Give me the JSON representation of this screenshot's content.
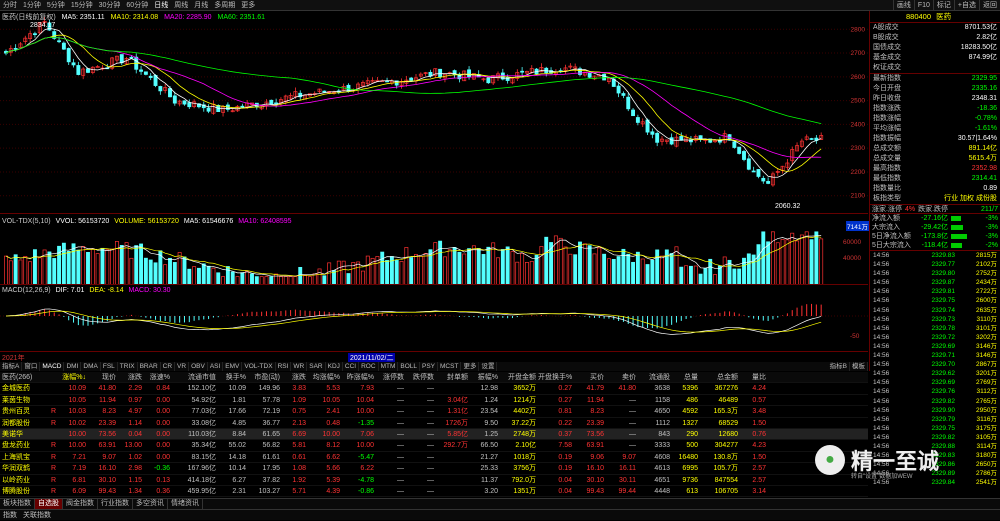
{
  "topbar": {
    "tabs": [
      "分时",
      "1分钟",
      "5分钟",
      "15分钟",
      "30分钟",
      "60分钟",
      "日线",
      "周线",
      "月线",
      "多周期",
      "更多"
    ],
    "active_tab": "日线",
    "right_tabs": [
      "画线",
      "F10",
      "标记",
      "+自选",
      "返回"
    ]
  },
  "main_legend": {
    "name": "医药(日线前复权)",
    "ma5": "MA5: 2351.11",
    "ma10": "MA10: 2314.08",
    "ma20": "MA20: 2285.90",
    "ma60": "MA60: 2351.61"
  },
  "main_labels": {
    "high": "2834.17",
    "low": "2060.32"
  },
  "y_axis": [
    "2800",
    "2700",
    "2600",
    "2500",
    "2400",
    "2300",
    "2200",
    "2100"
  ],
  "vol_legend": {
    "name": "VOL-TDX(5,10)",
    "vvol": "VVOL: 56153720",
    "volume": "VOLUME: 56153720",
    "ma5": "MA5: 61546676",
    "ma10": "MA10: 62408595",
    "max": "7141万",
    "y1": "40000",
    "y2": "60000"
  },
  "macd_legend": {
    "name": "MACD(12,26,9)",
    "dif": "DIF: 7.01",
    "dea": "DEA: -8.14",
    "macd": "MACD: 30.30",
    "y": "-50"
  },
  "time_axis": {
    "left": "2021年",
    "cursor": "2021/11/02/二"
  },
  "indicator_tabs": [
    "指标A",
    "窗口",
    "MACD",
    "DMI",
    "DMA",
    "FSL",
    "TRIX",
    "BRAR",
    "CR",
    "VR",
    "OBV",
    "ASI",
    "EMV",
    "VOL-TDX",
    "RSI",
    "WR",
    "SAR",
    "KDJ",
    "CCI",
    "ROC",
    "MTM",
    "BOLL",
    "PSY",
    "MCST",
    "更多",
    "设置"
  ],
  "indicator_right": [
    "指标B",
    "模板"
  ],
  "right_panel": {
    "code": "880400",
    "name": "医药",
    "stats1": [
      {
        "k": "A股成交",
        "v": "8701.53亿",
        "c": "#fff"
      },
      {
        "k": "B股成交",
        "v": "2.82亿",
        "c": "#fff"
      },
      {
        "k": "国债成交",
        "v": "18283.50亿",
        "c": "#fff"
      },
      {
        "k": "基金成交",
        "v": "874.99亿",
        "c": "#fff"
      },
      {
        "k": "权证成交",
        "v": "",
        "c": "#fff"
      }
    ],
    "stats2": [
      {
        "k": "最新指数",
        "v": "2329.95",
        "c": "#0f0"
      },
      {
        "k": "今日开盘",
        "v": "2335.16",
        "c": "#0f0"
      },
      {
        "k": "昨日收盘",
        "v": "2348.31",
        "c": "#fff"
      },
      {
        "k": "指数涨跌",
        "v": "-18.36",
        "c": "#0f0"
      },
      {
        "k": "指数涨幅",
        "v": "-0.78%",
        "c": "#0f0"
      },
      {
        "k": "平均涨幅",
        "v": "-1.61%",
        "c": "#0f0"
      },
      {
        "k": "指数振幅",
        "v": "30.57|1.64%",
        "c": "#fff"
      },
      {
        "k": "总成交额",
        "v": "891.14亿",
        "c": "#ff0"
      },
      {
        "k": "总成交量",
        "v": "5615.4万",
        "c": "#ff0"
      },
      {
        "k": "最高指数",
        "v": "2352.98",
        "c": "#f33"
      },
      {
        "k": "最低指数",
        "v": "2314.41",
        "c": "#0f0"
      },
      {
        "k": "指数量比",
        "v": "0.89",
        "c": "#fff"
      },
      {
        "k": "板指类型",
        "v": "行业 加权 成份股",
        "c": "#ff0"
      }
    ],
    "updown": {
      "label1": "涨家.涨停",
      "v1": "4%",
      "label2": "跌家.跌停",
      "v2": "211/7"
    },
    "flows": [
      {
        "k": "净流入额",
        "v": "-27.16亿",
        "p": "-3%",
        "w": 10
      },
      {
        "k": "大宗流入",
        "v": "-29.42亿",
        "p": "-3%",
        "w": 12
      },
      {
        "k": "5日净流入额",
        "v": "-173.8亿",
        "p": "-3%",
        "w": 16
      },
      {
        "k": "5日大宗流入",
        "v": "-118.4亿",
        "p": "-2%",
        "w": 11
      }
    ],
    "ticks": [
      {
        "t": "14:56",
        "p": "2329.83",
        "v": "2815万"
      },
      {
        "t": "14:56",
        "p": "2329.77",
        "v": "2102万"
      },
      {
        "t": "14:56",
        "p": "2329.80",
        "v": "2752万"
      },
      {
        "t": "14:56",
        "p": "2329.87",
        "v": "2434万"
      },
      {
        "t": "14:56",
        "p": "2329.81",
        "v": "2722万"
      },
      {
        "t": "14:56",
        "p": "2329.75",
        "v": "2600万"
      },
      {
        "t": "14:56",
        "p": "2329.74",
        "v": "2635万"
      },
      {
        "t": "14:56",
        "p": "2329.73",
        "v": "3110万"
      },
      {
        "t": "14:56",
        "p": "2329.78",
        "v": "3101万"
      },
      {
        "t": "14:56",
        "p": "2329.72",
        "v": "3202万"
      },
      {
        "t": "14:56",
        "p": "2329.69",
        "v": "3146万"
      },
      {
        "t": "14:56",
        "p": "2329.71",
        "v": "3146万"
      },
      {
        "t": "14:56",
        "p": "2329.70",
        "v": "2867万"
      },
      {
        "t": "14:56",
        "p": "2329.62",
        "v": "3201万"
      },
      {
        "t": "14:56",
        "p": "2329.69",
        "v": "2769万"
      },
      {
        "t": "14:56",
        "p": "2329.76",
        "v": "3112万"
      },
      {
        "t": "14:56",
        "p": "2329.82",
        "v": "2765万"
      },
      {
        "t": "14:56",
        "p": "2329.90",
        "v": "2950万"
      },
      {
        "t": "14:56",
        "p": "2329.79",
        "v": "3116万"
      },
      {
        "t": "14:56",
        "p": "2329.75",
        "v": "3175万"
      },
      {
        "t": "14:56",
        "p": "2329.82",
        "v": "3105万"
      },
      {
        "t": "14:56",
        "p": "2329.88",
        "v": "3114万"
      },
      {
        "t": "14:56",
        "p": "2329.83",
        "v": "3180万"
      },
      {
        "t": "14:56",
        "p": "2329.86",
        "v": "2650万"
      },
      {
        "t": "14:56",
        "p": "2329.89",
        "v": "2786万"
      },
      {
        "t": "14:56",
        "p": "2329.84",
        "v": "2541万"
      },
      {
        "t": "14:56",
        "p": "2329.87",
        "v": "541.0万"
      },
      {
        "t": "14:56",
        "p": "2329.95",
        "v": "5755万"
      }
    ]
  },
  "table": {
    "headers": [
      "医药(266)",
      "",
      "涨幅%↓",
      "现价",
      "涨跌",
      "涨速%",
      "流通市值",
      "换手%",
      "市盈(动)",
      "涨跌",
      "均涨幅%",
      "昨涨幅%",
      "涨停数",
      "跌停数",
      "封单额",
      "振幅%",
      "开盘金额",
      "开盘换手%",
      "买价",
      "卖价",
      "流通股",
      "总量",
      "总金额",
      "量比"
    ],
    "rows": [
      [
        "金城医药",
        "",
        "10.09",
        "41.80",
        "2.29",
        "0.84",
        "152.10亿",
        "10.09",
        "149.96",
        "3.83",
        "5.53",
        "7.93",
        "—",
        "—",
        "",
        "12.98",
        "3652万",
        "0.27",
        "41.79",
        "41.80",
        "3638",
        "5396",
        "367276",
        "4.24"
      ],
      [
        "莱茵生物",
        "",
        "10.05",
        "11.94",
        "0.97",
        "0.00",
        "54.92亿",
        "1.81",
        "57.78",
        "1.09",
        "10.05",
        "10.04",
        "—",
        "—",
        "3.04亿",
        "1.24",
        "1214万",
        "0.27",
        "11.94",
        "—",
        "1158",
        "486",
        "46489",
        "0.57"
      ],
      [
        "贵州百灵",
        "R",
        "10.03",
        "8.23",
        "4.97",
        "0.00",
        "77.03亿",
        "17.66",
        "72.19",
        "0.75",
        "2.41",
        "10.00",
        "—",
        "—",
        "1.31亿",
        "23.54",
        "4402万",
        "0.81",
        "8.23",
        "—",
        "4650",
        "4592",
        "165.3万",
        "3.48"
      ],
      [
        "润都股份",
        "R",
        "10.02",
        "23.39",
        "1.14",
        "0.00",
        "33.08亿",
        "4.85",
        "36.77",
        "2.13",
        "0.48",
        "-1.35",
        "—",
        "—",
        "1726万",
        "9.50",
        "37.22万",
        "0.22",
        "23.39",
        "—",
        "1112",
        "1327",
        "68529",
        "1.50"
      ],
      [
        "美诺华",
        "",
        "10.00",
        "73.56",
        "0.04",
        "0.00",
        "110.03亿",
        "8.84",
        "61.65",
        "6.69",
        "10.00",
        "7.06",
        "—",
        "—",
        "5.85亿",
        "1.25",
        "2748万",
        "0.37",
        "73.56",
        "—",
        "843",
        "290",
        "12680",
        "0.76"
      ],
      [
        "盘龙药业",
        "R",
        "10.00",
        "63.91",
        "13.00",
        "0.00",
        "35.34亿",
        "55.02",
        "56.82",
        "5.81",
        "8.12",
        "10.00",
        "—",
        "—",
        "292.7万",
        "66.50",
        "2.10亿",
        "7.58",
        "63.91",
        "—",
        "3333",
        "500",
        "304277",
        "4.23"
      ],
      [
        "上海凯宝",
        "R",
        "7.21",
        "9.07",
        "1.02",
        "0.00",
        "83.15亿",
        "14.18",
        "61.61",
        "0.61",
        "6.62",
        "-5.47",
        "—",
        "—",
        "",
        "21.27",
        "1018万",
        "0.19",
        "9.06",
        "9.07",
        "4608",
        "16480",
        "130.8万",
        "1.50"
      ],
      [
        "华润双鹤",
        "R",
        "7.19",
        "16.10",
        "2.98",
        "-0.36",
        "167.96亿",
        "10.14",
        "17.95",
        "1.08",
        "5.66",
        "6.22",
        "—",
        "—",
        "",
        "25.33",
        "3756万",
        "0.19",
        "16.10",
        "16.11",
        "4613",
        "6995",
        "105.7万",
        "2.57"
      ],
      [
        "以岭药业",
        "R",
        "6.81",
        "30.10",
        "1.15",
        "0.13",
        "414.18亿",
        "6.27",
        "37.82",
        "1.92",
        "5.39",
        "-4.78",
        "—",
        "—",
        "",
        "11.37",
        "792.0万",
        "0.04",
        "30.10",
        "30.11",
        "4651",
        "9736",
        "847554",
        "2.57"
      ],
      [
        "博腾股份",
        "R",
        "6.09",
        "99.43",
        "1.34",
        "0.36",
        "459.95亿",
        "2.31",
        "103.27",
        "5.71",
        "4.39",
        "-0.86",
        "—",
        "—",
        "",
        "3.20",
        "1351万",
        "0.04",
        "99.43",
        "99.44",
        "4448",
        "613",
        "106705",
        "3.14"
      ]
    ]
  },
  "bottom_tabs": [
    "板块指数",
    "自选股",
    "阀金指数",
    "行业指数",
    "多空资讯",
    "情绪资讯"
  ],
  "bottom_tabs_active": "自选股",
  "status": [
    "指数",
    "关联指数"
  ],
  "watermark": {
    "name": "精一至诚",
    "sub": "转自\"设置\"数据加WEW"
  },
  "colors": {
    "up": "#ff3232",
    "down": "#54ffff",
    "ma5": "#ffffff",
    "ma10": "#ffff00",
    "ma20": "#ff00ff",
    "ma60": "#00ff00"
  }
}
